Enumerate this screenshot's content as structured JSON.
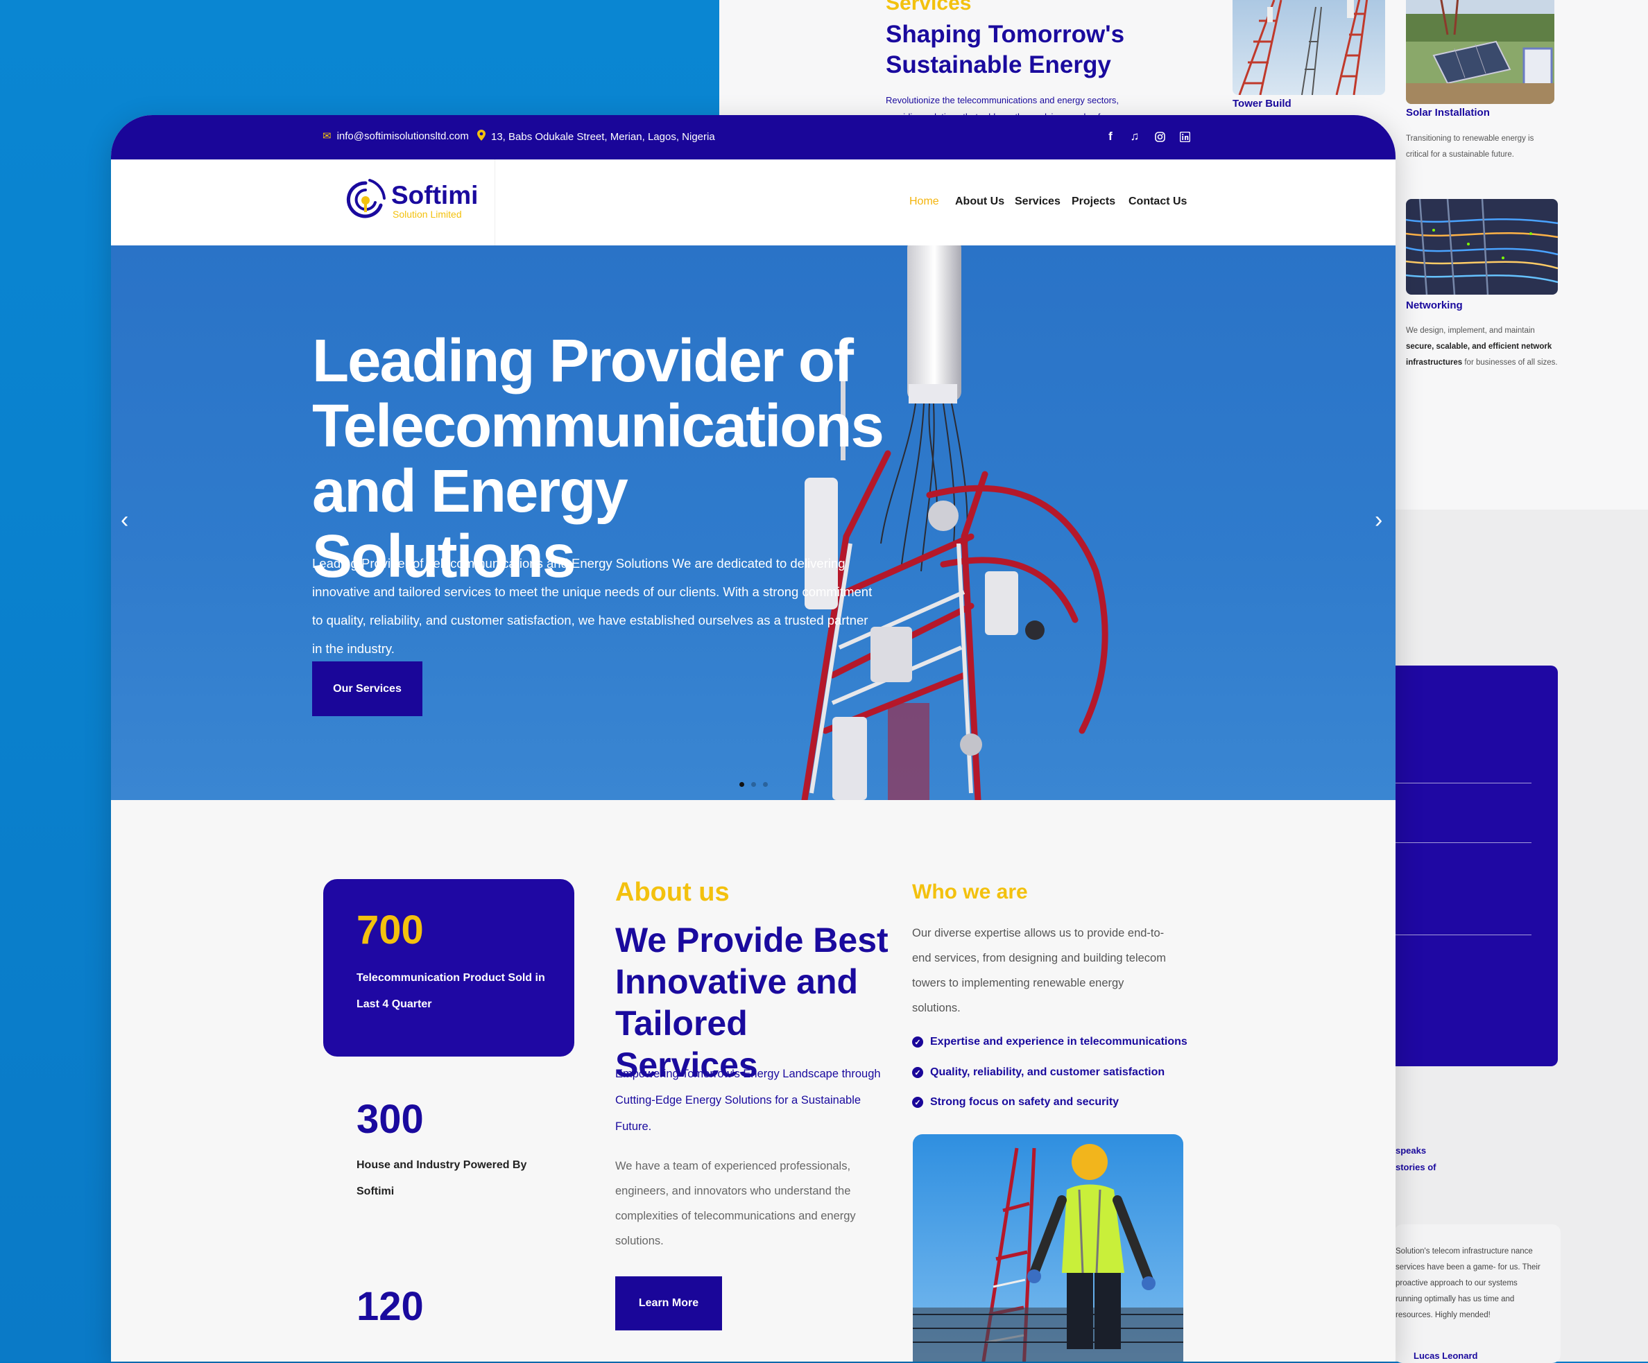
{
  "background": {
    "services_kicker": "Services",
    "services_title": "Shaping Tomorrow's Sustainable Energy",
    "services_desc": "Revolutionize the telecommunications and energy sectors, providing solutions that address the evolving needs of",
    "cards": [
      {
        "caption": "Tower Build"
      },
      {
        "caption": "Solar Installation",
        "desc": "Transitioning to renewable energy is critical for a sustainable future."
      },
      {
        "caption": "Networking",
        "desc_parts": [
          "We design, implement, and maintain ",
          "secure, scalable, and efficient network infrastructures",
          " for businesses of all sizes."
        ]
      }
    ],
    "snippet1": "speaks",
    "snippet2": "stories of",
    "testimonial": "Solution's telecom infrastructure nance services have been a game- for us. Their proactive approach to our systems running optimally has us time and resources. Highly mended!",
    "testimonial_author": "Lucas Leonard"
  },
  "topbar": {
    "email": "info@softimisolutionsltd.com",
    "address": "13, Babs Odukale Street, Merian, Lagos, Nigeria",
    "social": [
      "facebook-icon",
      "tiktok-icon",
      "instagram-icon",
      "linkedin-icon"
    ]
  },
  "logo": {
    "name": "Softimi",
    "sub": "Solution Limited"
  },
  "nav": {
    "home": "Home",
    "about": "About Us",
    "services": "Services",
    "projects": "Projects",
    "contact": "Contact Us"
  },
  "hero": {
    "title": "Leading Provider of Telecommunications and Energy Solutions",
    "text": "Leading Provider of Telecommunications and Energy Solutions We are dedicated to delivering innovative and tailored services to meet the unique needs of our clients. With a strong commitment to quality, reliability, and customer satisfaction, we have established ourselves as a trusted partner in the industry.",
    "button": "Our Services",
    "slides": 3,
    "active_slide": 1
  },
  "stats": [
    {
      "value": "700",
      "label": "Telecommunication Product Sold in Last 4 Quarter"
    },
    {
      "value": "300",
      "label": "House and Industry Powered By Softimi"
    },
    {
      "value": "120",
      "label": ""
    }
  ],
  "about": {
    "kicker": "About us",
    "title": "We Provide Best Innovative and Tailored Services",
    "subtitle": "Empowering Tomorrow's Energy Landscape through Cutting-Edge Energy Solutions for a Sustainable Future.",
    "body": "We have a team of experienced professionals, engineers, and innovators who understand the complexities of telecommunications and energy solutions.",
    "button": "Learn More"
  },
  "who": {
    "kicker": "Who we are",
    "body": "Our diverse expertise allows us to provide end-to-end services, from designing and building telecom towers to implementing renewable energy solutions.",
    "checks": [
      "Expertise and experience in telecommunications",
      "Quality, reliability, and customer satisfaction",
      "Strong focus on safety and security"
    ]
  },
  "colors": {
    "primary": "#1a0699",
    "accent": "#f3c10e",
    "hero_sky": "#2f7bcc"
  }
}
